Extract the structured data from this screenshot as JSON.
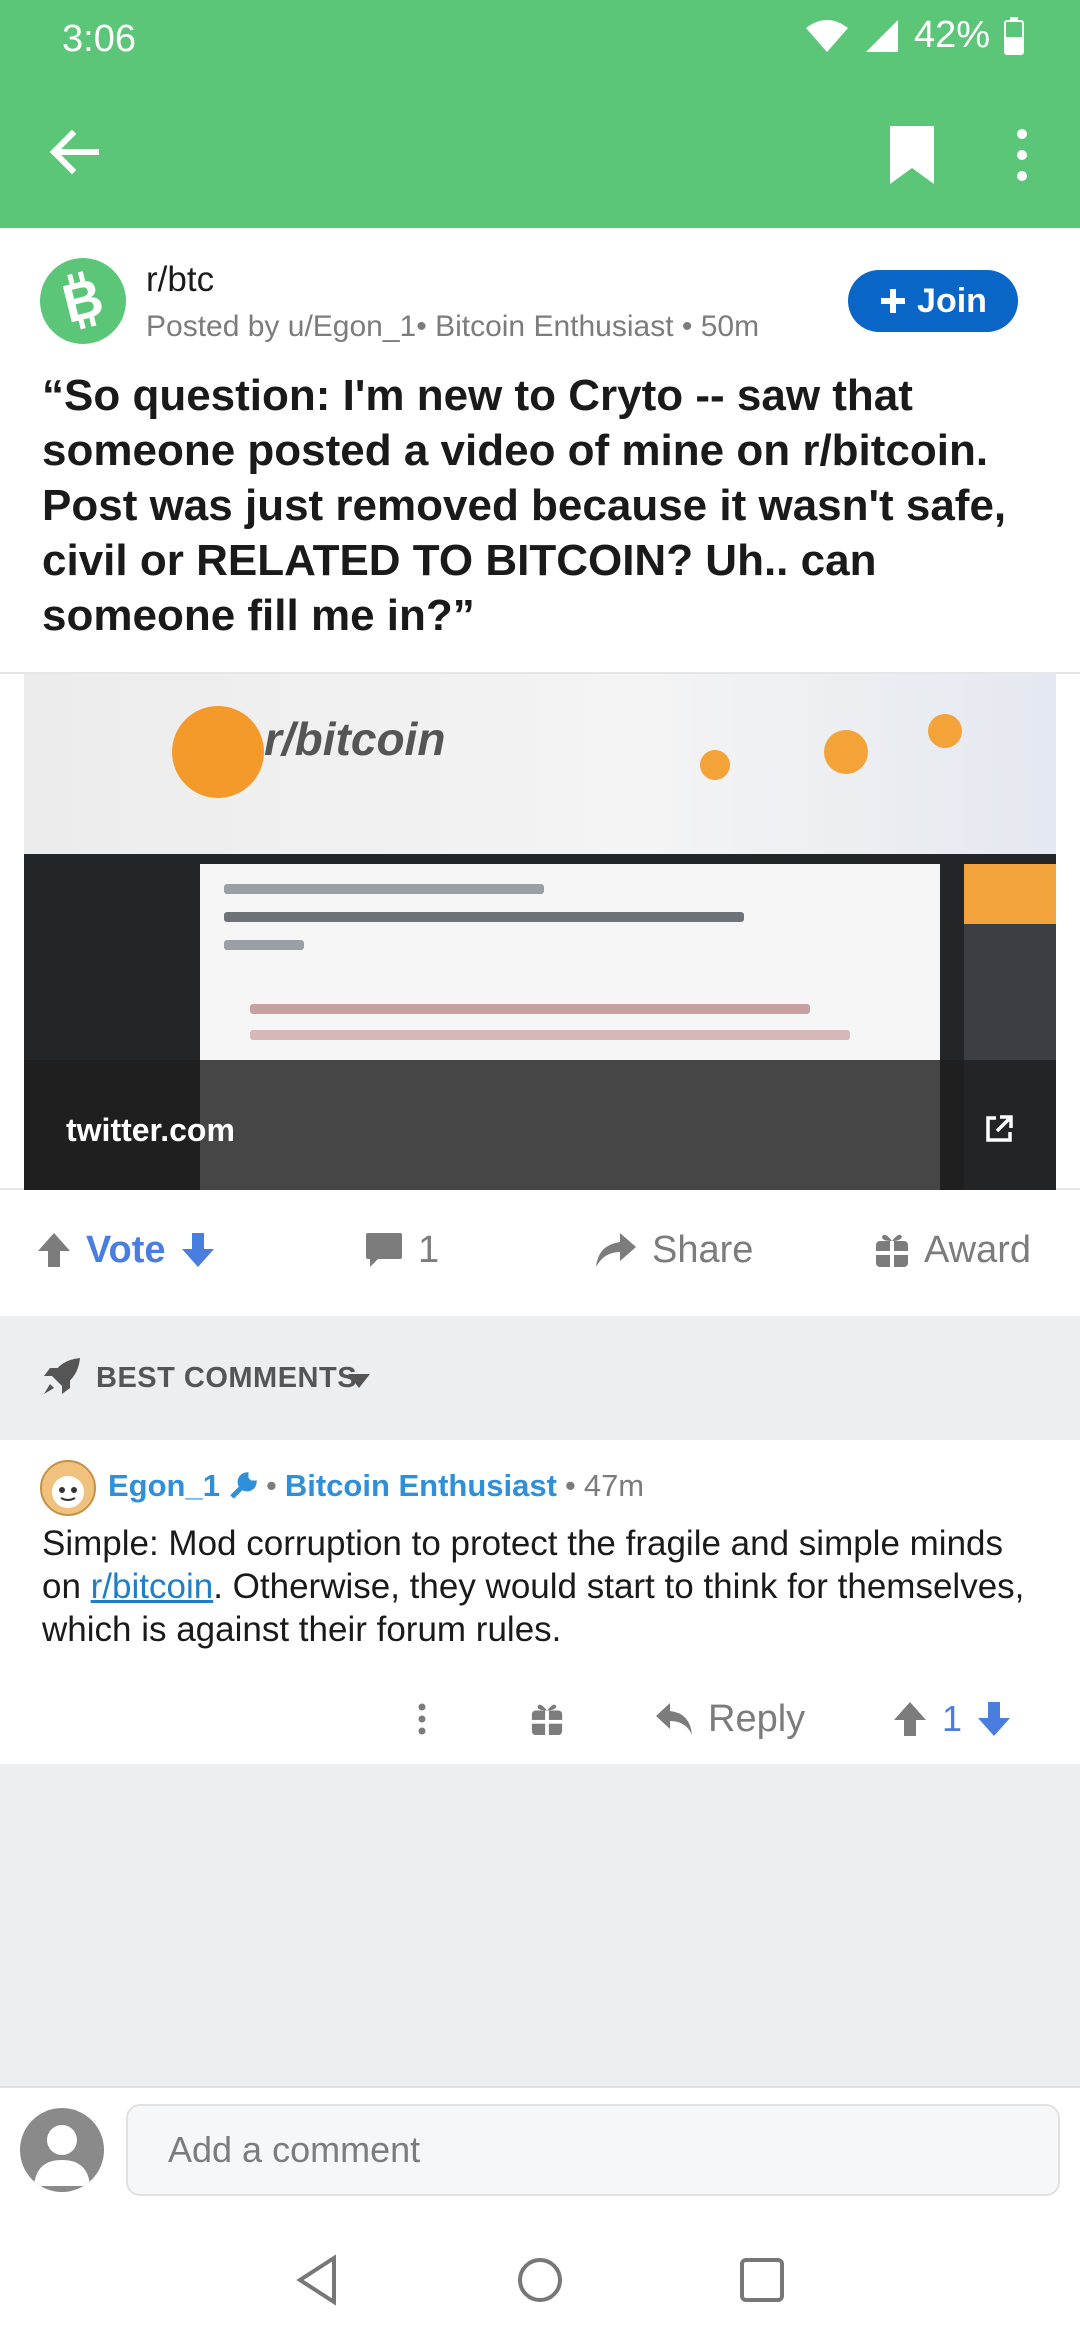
{
  "status_bar": {
    "time": "3:06",
    "battery": "42%"
  },
  "post": {
    "subreddit": "r/btc",
    "posted_by": "Posted by u/Egon_1",
    "flair": "Bitcoin Enthusiast",
    "age": "50m",
    "join_label": "Join",
    "title": "“So question: I'm new to Cryto -- saw that someone posted a video of mine on r/bitcoin. Post was just removed because it wasn't safe, civil or RELATED TO BITCOIN? Uh.. can someone fill me in?”",
    "link_domain": "twitter.com",
    "thumbnail_text": "r/bitcoin",
    "vote_label": "Vote",
    "comment_count": "1",
    "share_label": "Share",
    "award_label": "Award"
  },
  "sort": {
    "label": "BEST COMMENTS"
  },
  "comment": {
    "author": "Egon_1",
    "flair": "Bitcoin Enthusiast",
    "age": "47m",
    "body_before": "Simple: Mod corruption to protect the fragile and simple minds on ",
    "body_link": "r/bitcoin",
    "body_after": ". Otherwise, they would start to think for themselves, which is against their forum rules.",
    "reply_label": "Reply",
    "score": "1"
  },
  "compose": {
    "placeholder": "Add a comment"
  },
  "colors": {
    "accent_green": "#5cc678",
    "join_blue": "#0a66c6",
    "vote_blue": "#4a7de0",
    "link_blue": "#2f8fd9"
  }
}
